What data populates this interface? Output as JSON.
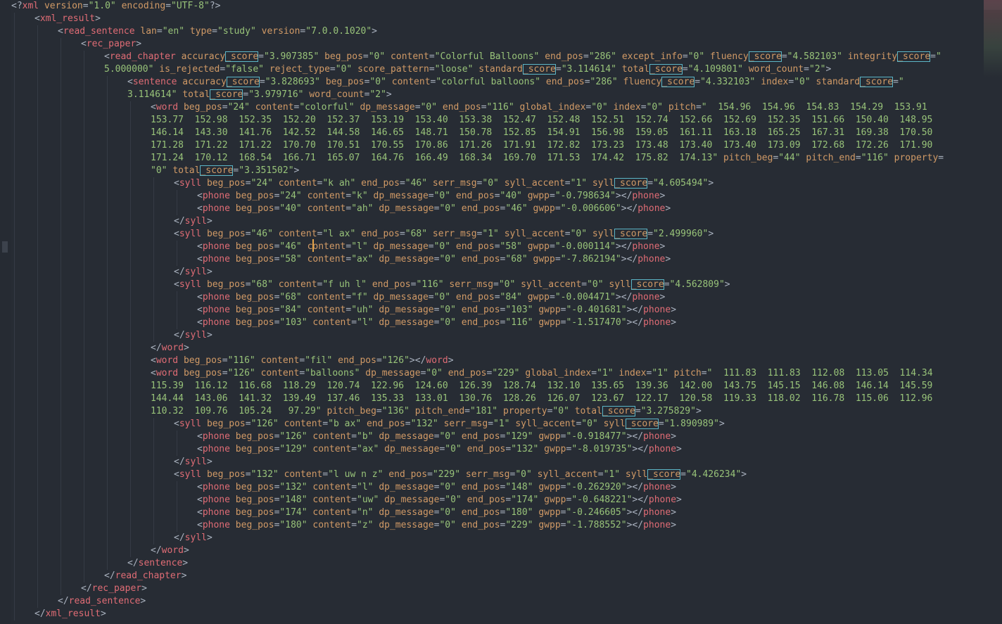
{
  "editor": {
    "language": "xml",
    "highlight_word": "_score",
    "lines": [
      {
        "indent": 0,
        "text": "<?xml version=\"1.0\" encoding=\"UTF-8\"?>"
      },
      {
        "indent": 1,
        "text": "<xml_result>"
      },
      {
        "indent": 2,
        "text": "<read_sentence lan=\"en\" type=\"study\" version=\"7.0.0.1020\">"
      },
      {
        "indent": 3,
        "text": "<rec_paper>"
      },
      {
        "indent": 4,
        "text": "<read_chapter accuracy_score=\"3.907385\" beg_pos=\"0\" content=\"Colorful Balloons\" end_pos=\"286\" except_info=\"0\" fluency_score=\"4.582103\" integrity_score=\""
      },
      {
        "indent": 4,
        "text": "5.000000\" is_rejected=\"false\" reject_type=\"0\" score_pattern=\"loose\" standard_score=\"3.114614\" total_score=\"4.109801\" word_count=\"2\">"
      },
      {
        "indent": 5,
        "text": "<sentence accuracy_score=\"3.828693\" beg_pos=\"0\" content=\"colorful balloons\" end_pos=\"286\" fluency_score=\"4.332103\" index=\"0\" standard_score=\""
      },
      {
        "indent": 5,
        "text": "3.114614\" total_score=\"3.979716\" word_count=\"2\">"
      },
      {
        "indent": 6,
        "text": "<word beg_pos=\"24\" content=\"colorful\" dp_message=\"0\" end_pos=\"116\" global_index=\"0\" index=\"0\" pitch=\"  154.96  154.96  154.83  154.29  153.91"
      },
      {
        "indent": 6,
        "text": "153.77  152.98  152.35  152.20  152.37  153.19  153.40  153.38  152.47  152.48  152.51  152.74  152.66  152.69  152.35  151.66  150.40  148.95"
      },
      {
        "indent": 6,
        "text": "146.14  143.30  141.76  142.52  144.58  146.65  148.71  150.78  152.85  154.91  156.98  159.05  161.11  163.18  165.25  167.31  169.38  170.50"
      },
      {
        "indent": 6,
        "text": "171.28  171.22  171.22  170.70  170.51  170.55  170.86  171.26  171.91  172.82  173.23  173.48  173.40  173.40  173.09  172.68  172.26  171.90"
      },
      {
        "indent": 6,
        "text": "171.24  170.12  168.54  166.71  165.07  164.76  166.49  168.34  169.70  171.53  174.42  175.82  174.13\" pitch_beg=\"44\" pitch_end=\"116\" property="
      },
      {
        "indent": 6,
        "text": "\"0\" total_score=\"3.351502\">"
      },
      {
        "indent": 7,
        "text": "<syll beg_pos=\"24\" content=\"k ah\" end_pos=\"46\" serr_msg=\"0\" syll_accent=\"1\" syll_score=\"4.605494\">"
      },
      {
        "indent": 8,
        "text": "<phone beg_pos=\"24\" content=\"k\" dp_message=\"0\" end_pos=\"40\" gwpp=\"-0.798634\"></phone>"
      },
      {
        "indent": 8,
        "text": "<phone beg_pos=\"40\" content=\"ah\" dp_message=\"0\" end_pos=\"46\" gwpp=\"-0.006606\"></phone>"
      },
      {
        "indent": 7,
        "text": "</syll>"
      },
      {
        "indent": 7,
        "text": "<syll beg_pos=\"46\" content=\"l ax\" end_pos=\"68\" serr_msg=\"1\" syll_accent=\"0\" syll_score=\"2.499960\">"
      },
      {
        "indent": 8,
        "text": "<phone beg_pos=\"46\" content=\"l\" dp_message=\"0\" end_pos=\"58\" gwpp=\"-0.000114\"></phone>"
      },
      {
        "indent": 8,
        "text": "<phone beg_pos=\"58\" content=\"ax\" dp_message=\"0\" end_pos=\"68\" gwpp=\"-7.862194\"></phone>"
      },
      {
        "indent": 7,
        "text": "</syll>"
      },
      {
        "indent": 7,
        "text": "<syll beg_pos=\"68\" content=\"f uh l\" end_pos=\"116\" serr_msg=\"0\" syll_accent=\"0\" syll_score=\"4.562809\">"
      },
      {
        "indent": 8,
        "text": "<phone beg_pos=\"68\" content=\"f\" dp_message=\"0\" end_pos=\"84\" gwpp=\"-0.004471\"></phone>"
      },
      {
        "indent": 8,
        "text": "<phone beg_pos=\"84\" content=\"uh\" dp_message=\"0\" end_pos=\"103\" gwpp=\"-0.401681\"></phone>"
      },
      {
        "indent": 8,
        "text": "<phone beg_pos=\"103\" content=\"l\" dp_message=\"0\" end_pos=\"116\" gwpp=\"-1.517470\"></phone>"
      },
      {
        "indent": 7,
        "text": "</syll>"
      },
      {
        "indent": 6,
        "text": "</word>"
      },
      {
        "indent": 6,
        "text": "<word beg_pos=\"116\" content=\"fil\" end_pos=\"126\"></word>"
      },
      {
        "indent": 6,
        "text": "<word beg_pos=\"126\" content=\"balloons\" dp_message=\"0\" end_pos=\"229\" global_index=\"1\" index=\"1\" pitch=\"  111.83  111.83  112.08  113.05  114.34"
      },
      {
        "indent": 6,
        "text": "115.39  116.12  116.68  118.29  120.74  122.96  124.60  126.39  128.74  132.10  135.65  139.36  142.00  143.75  145.15  146.08  146.14  145.59"
      },
      {
        "indent": 6,
        "text": "144.44  143.06  141.32  139.49  137.46  135.33  133.01  130.76  128.26  126.07  123.67  122.17  120.58  119.33  118.02  116.78  115.06  112.96"
      },
      {
        "indent": 6,
        "text": "110.32  109.76  105.24   97.29\" pitch_beg=\"136\" pitch_end=\"181\" property=\"0\" total_score=\"3.275829\">"
      },
      {
        "indent": 7,
        "text": "<syll beg_pos=\"126\" content=\"b ax\" end_pos=\"132\" serr_msg=\"1\" syll_accent=\"0\" syll_score=\"1.890989\">"
      },
      {
        "indent": 8,
        "text": "<phone beg_pos=\"126\" content=\"b\" dp_message=\"0\" end_pos=\"129\" gwpp=\"-0.918477\"></phone>"
      },
      {
        "indent": 8,
        "text": "<phone beg_pos=\"129\" content=\"ax\" dp_message=\"0\" end_pos=\"132\" gwpp=\"-8.019735\"></phone>"
      },
      {
        "indent": 7,
        "text": "</syll>"
      },
      {
        "indent": 7,
        "text": "<syll beg_pos=\"132\" content=\"l uw n z\" end_pos=\"229\" serr_msg=\"0\" syll_accent=\"1\" syll_score=\"4.426234\">"
      },
      {
        "indent": 8,
        "text": "<phone beg_pos=\"132\" content=\"l\" dp_message=\"0\" end_pos=\"148\" gwpp=\"-0.262920\"></phone>"
      },
      {
        "indent": 8,
        "text": "<phone beg_pos=\"148\" content=\"uw\" dp_message=\"0\" end_pos=\"174\" gwpp=\"-0.648221\"></phone>"
      },
      {
        "indent": 8,
        "text": "<phone beg_pos=\"174\" content=\"n\" dp_message=\"0\" end_pos=\"180\" gwpp=\"-0.246605\"></phone>"
      },
      {
        "indent": 8,
        "text": "<phone beg_pos=\"180\" content=\"z\" dp_message=\"0\" end_pos=\"229\" gwpp=\"-1.788552\"></phone>"
      },
      {
        "indent": 7,
        "text": "</syll>"
      },
      {
        "indent": 6,
        "text": "</word>"
      },
      {
        "indent": 5,
        "text": "</sentence>"
      },
      {
        "indent": 4,
        "text": "</read_chapter>"
      },
      {
        "indent": 3,
        "text": "</rec_paper>"
      },
      {
        "indent": 2,
        "text": "</read_sentence>"
      },
      {
        "indent": 1,
        "text": "</xml_result>"
      }
    ]
  },
  "colors": {
    "background": "#272c34",
    "tag": "#e06c75",
    "attribute": "#d19a66",
    "string": "#98c379",
    "punctuation": "#aab2bf",
    "highlight": "#5cb6c7",
    "cursor": "#e5a44a"
  }
}
